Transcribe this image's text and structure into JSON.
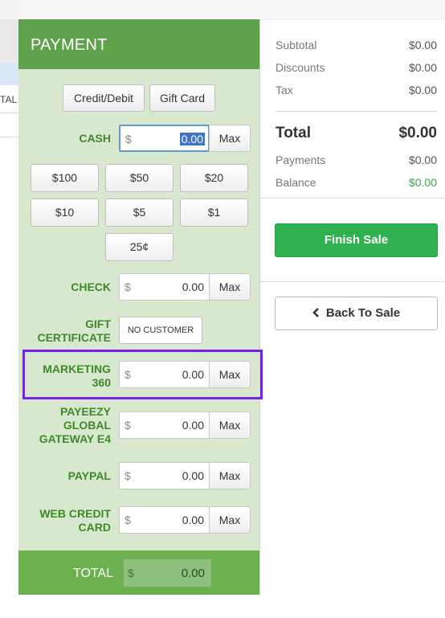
{
  "background": {
    "left_text": "TAL"
  },
  "payment": {
    "title": "PAYMENT",
    "tabs": [
      "Credit/Debit",
      "Gift Card"
    ],
    "cash": {
      "label": "CASH",
      "currency": "$",
      "value": "0.00",
      "max": "Max"
    },
    "quick_amounts": [
      "$100",
      "$50",
      "$20",
      "$10",
      "$5",
      "$1",
      "25¢"
    ],
    "check": {
      "label": "CHECK",
      "currency": "$",
      "value": "0.00",
      "max": "Max"
    },
    "gift_certificate": {
      "label_line1": "GIFT",
      "label_line2": "CERTIFICATE",
      "button": "NO CUSTOMER"
    },
    "marketing": {
      "label_line1": "MARKETING",
      "label_line2": "360",
      "currency": "$",
      "value": "0.00",
      "max": "Max"
    },
    "payeezy": {
      "label_line1": "PAYEEZY",
      "label_line2": "GLOBAL",
      "label_line3": "GATEWAY E4",
      "currency": "$",
      "value": "0.00",
      "max": "Max"
    },
    "paypal": {
      "label": "PAYPAL",
      "currency": "$",
      "value": "0.00",
      "max": "Max"
    },
    "web_credit": {
      "label_line1": "WEB CREDIT",
      "label_line2": "CARD",
      "currency": "$",
      "value": "0.00",
      "max": "Max"
    },
    "total": {
      "label": "TOTAL",
      "currency": "$",
      "value": "0.00"
    }
  },
  "summary": {
    "subtotal": {
      "label": "Subtotal",
      "value": "$0.00"
    },
    "discounts": {
      "label": "Discounts",
      "value": "$0.00"
    },
    "tax": {
      "label": "Tax",
      "value": "$0.00"
    },
    "total": {
      "label": "Total",
      "value": "$0.00"
    },
    "payments": {
      "label": "Payments",
      "value": "$0.00"
    },
    "balance": {
      "label": "Balance",
      "value": "$0.00"
    },
    "finish_sale": "Finish Sale",
    "back_to_sale": "Back To Sale"
  },
  "colors": {
    "panel_bg": "#d8e8cf",
    "header_green": "#5fa24b",
    "label_green": "#3d8a26",
    "finish_green": "#2fb14f",
    "balance_green": "#3aa84f",
    "highlight_purple": "#7a1ff0"
  }
}
